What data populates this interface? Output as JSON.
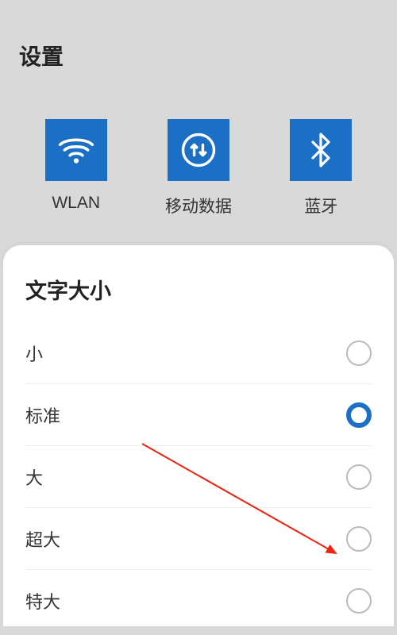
{
  "header": {
    "title": "设置"
  },
  "tiles": [
    {
      "label": "WLAN",
      "icon": "wifi-icon"
    },
    {
      "label": "移动数据",
      "icon": "data-icon"
    },
    {
      "label": "蓝牙",
      "icon": "bluetooth-icon"
    }
  ],
  "card": {
    "title": "文字大小"
  },
  "options": [
    {
      "label": "小",
      "selected": false
    },
    {
      "label": "标准",
      "selected": true
    },
    {
      "label": "大",
      "selected": false
    },
    {
      "label": "超大",
      "selected": false
    },
    {
      "label": "特大",
      "selected": false
    }
  ],
  "colors": {
    "accent": "#1b6fc4"
  }
}
